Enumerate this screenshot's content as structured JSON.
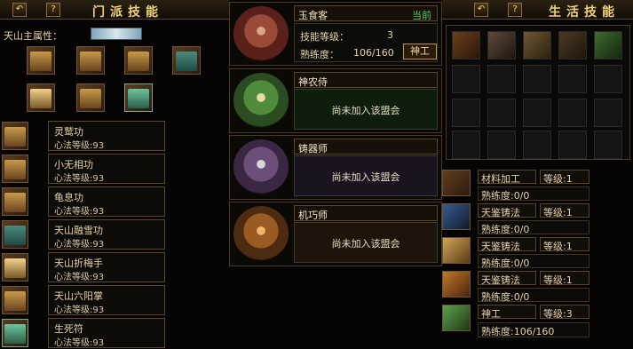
{
  "left": {
    "title": "门派技能",
    "attr_label": "天山主属性：",
    "skills": [
      {
        "name": "灵鹫功",
        "level": "心法等级:93"
      },
      {
        "name": "小无相功",
        "level": "心法等级:93"
      },
      {
        "name": "龟息功",
        "level": "心法等级:93"
      },
      {
        "name": "天山融雪功",
        "level": "心法等级:93"
      },
      {
        "name": "天山折梅手",
        "level": "心法等级:93"
      },
      {
        "name": "天山六阳掌",
        "level": "心法等级:93"
      },
      {
        "name": "生死符",
        "level": "心法等级:93"
      }
    ]
  },
  "mid": {
    "cards": [
      {
        "name": "玉食客",
        "badge": "当前",
        "skill_level_label": "技能等级：",
        "skill_level_value": "3",
        "prof_label": "熟练度：",
        "prof_value": "106/160",
        "button": "神工"
      },
      {
        "name": "神农侍",
        "notice": "尚未加入该盟会"
      },
      {
        "name": "铸器师",
        "notice": "尚未加入该盟会"
      },
      {
        "name": "机巧师",
        "notice": "尚未加入该盟会"
      }
    ]
  },
  "right": {
    "title": "生活技能",
    "rows": [
      {
        "name": "材料加工",
        "level": "等级:1",
        "prof": "熟练度:0/0"
      },
      {
        "name": "天鉴铸法",
        "level": "等级:1",
        "prof": "熟练度:0/0"
      },
      {
        "name": "天鉴铸法",
        "level": "等级:1",
        "prof": "熟练度:0/0"
      },
      {
        "name": "天鉴铸法",
        "level": "等级:1",
        "prof": "熟练度:0/0"
      },
      {
        "name": "神工",
        "level": "等级:3",
        "prof": "熟练度:106/160"
      }
    ]
  },
  "icons": {
    "back": "back-arrow-icon",
    "help": "help-icon"
  }
}
